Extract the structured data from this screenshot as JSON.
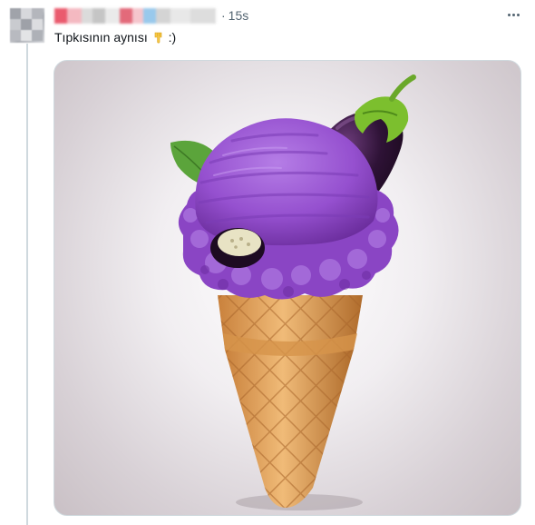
{
  "post": {
    "timestamp": "15s",
    "separator": "·",
    "text": "Tıpkısının aynısı",
    "text_suffix": ":)",
    "emoji_icon": "pointing-down-hand-icon",
    "more_icon": "more-options-icon"
  },
  "media": {
    "subject": "ice-cream-cone-eggplant-icon"
  },
  "colors": {
    "scoop": "#9b55d4",
    "scoop_dark": "#6a2a9a",
    "cone": "#e2a25a",
    "eggplant": "#3a1840",
    "stem": "#7cbf2e",
    "leaf": "#5ba43b",
    "meta_text": "#536471"
  }
}
